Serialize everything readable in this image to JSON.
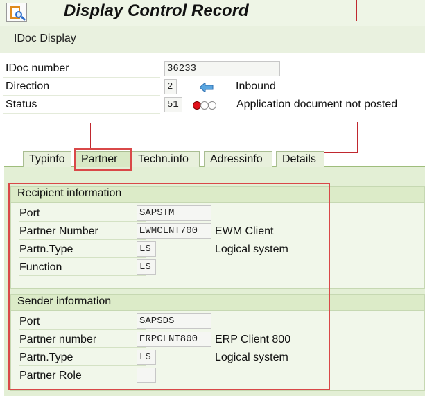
{
  "title": "Display Control Record",
  "toolbar": {
    "idoc_display_label": "IDoc Display"
  },
  "header": {
    "idoc_number_label": "IDoc number",
    "idoc_number_value": "36233",
    "direction_label": "Direction",
    "direction_value": "2",
    "direction_text": "Inbound",
    "status_label": "Status",
    "status_value": "51",
    "status_text": "Application document not posted"
  },
  "tabs": [
    {
      "label": "Typinfo"
    },
    {
      "label": "Partner"
    },
    {
      "label": "Techn.info"
    },
    {
      "label": "Adressinfo"
    },
    {
      "label": "Details"
    }
  ],
  "recipient": {
    "title": "Recipient information",
    "port_label": "Port",
    "port_value": "SAPSTM",
    "partner_number_label": "Partner Number",
    "partner_number_value": "EWMCLNT700",
    "partner_number_desc": "EWM Client",
    "partn_type_label": "Partn.Type",
    "partn_type_value": "LS",
    "partn_type_desc": "Logical system",
    "function_label": "Function",
    "function_value": "LS"
  },
  "sender": {
    "title": "Sender information",
    "port_label": "Port",
    "port_value": "SAPSDS",
    "partner_number_label": "Partner number",
    "partner_number_value": "ERPCLNT800",
    "partner_number_desc": "ERP Client 800",
    "partn_type_label": "Partn.Type",
    "partn_type_value": "LS",
    "partn_type_desc": "Logical system",
    "partner_role_label": "Partner Role",
    "partner_role_value": ""
  },
  "colors": {
    "accent_green": "#e3efd5",
    "highlight_red": "#d94848",
    "status_red": "#e0101a"
  },
  "icons": {
    "title": "idoc-display-icon",
    "direction": "inbound-arrow-icon",
    "status": "traffic-light-red-icon"
  }
}
